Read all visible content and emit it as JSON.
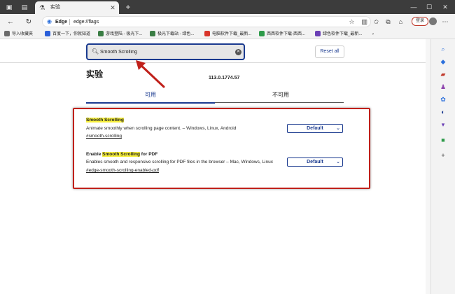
{
  "tab": {
    "title": "实验"
  },
  "address": {
    "site_label": "Edge",
    "url": "edge://flags"
  },
  "toolbar": {
    "login_label": "登录"
  },
  "favorites": [
    {
      "label": "导入收藏夹",
      "color": "#6b6b6b"
    },
    {
      "label": "百度一下，你就知道",
      "color": "#2b5fd9"
    },
    {
      "label": "游戏登陆 - 极光下...",
      "color": "#3a7d44"
    },
    {
      "label": "极光下载站 - 绿色...",
      "color": "#3a7d44"
    },
    {
      "label": "电脑软件下载_最新...",
      "color": "#d9352b"
    },
    {
      "label": "西西软件下载-西西...",
      "color": "#2e9b4a"
    },
    {
      "label": "绿色软件下载_最新...",
      "color": "#6a3fb5"
    }
  ],
  "search": {
    "value": "Smooth Scrolling"
  },
  "reset_label": "Reset all",
  "page": {
    "heading": "实验",
    "version": "113.0.1774.57",
    "tab_available": "可用",
    "tab_unavailable": "不可用"
  },
  "experiments": [
    {
      "title_before": "",
      "title_match": "Smooth Scrolling",
      "title_after": "",
      "description": "Animate smoothly when scrolling page content. – Windows, Linux, Android",
      "link": "#smooth-scrolling",
      "select_value": "Default"
    },
    {
      "title_before": "Enable ",
      "title_match": "Smooth Scrolling",
      "title_after": " for PDF",
      "description": "Enables smooth and responsive scrolling for PDF files in the browser – Mac, Windows, Linux",
      "link": "#edge-smooth-scrolling-enabled-pdf",
      "select_value": "Default"
    }
  ],
  "colors": {
    "accent": "#1a3a8f",
    "highlight": "#f7ef3c",
    "annotation": "#c0201a"
  }
}
